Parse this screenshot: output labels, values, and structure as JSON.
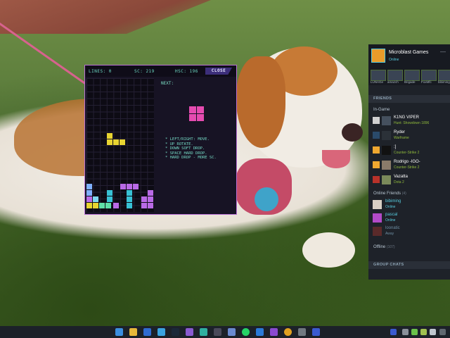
{
  "tetris": {
    "lines_label": "LINES: 0",
    "score_label": "SC: 219",
    "hiscore_label": "HSC: 196",
    "close_label": "CLOSE",
    "next_label": "NEXT:",
    "help_text": "* LEFT/RIGHT: MOVE.\n* UP ROTATE.\n* DOWN SOFT DROP.\n* SPACE HARD DROP.\n* HARD DROP - MORE SC."
  },
  "steam": {
    "profile_name": "Microblast Games",
    "profile_status": "Online",
    "minimize_icon": "minimize-icon",
    "recent": [
      {
        "name": "LUNAGe"
      },
      {
        "name": "amazch"
      },
      {
        "name": "Brigade"
      },
      {
        "name": "FoxMfc"
      },
      {
        "name": "bibiming"
      }
    ],
    "friends_header": "FRIENDS",
    "in_game_label": "In-Game",
    "in_game": [
      {
        "name": "K1NG VIPER",
        "game": "Hunt: Showdown 1896",
        "icon": "arrows-icon"
      },
      {
        "name": "Ryder",
        "game": "Warframe",
        "icon": "steam-icon"
      },
      {
        "name": ":]",
        "game": "Counter-Strike 2",
        "icon": "cs2-icon"
      },
      {
        "name": "Rodrigo -IGO-",
        "game": "Counter-Strike 2",
        "icon": "cs2-icon"
      },
      {
        "name": "Vazatta",
        "game": "Dota 2",
        "icon": "dota-icon"
      }
    ],
    "online_label": "Online Friends",
    "online_count": "(4)",
    "online": [
      {
        "name": "bibiming",
        "status": "Online"
      },
      {
        "name": "pascal",
        "status": "Online"
      },
      {
        "name": "loonatic",
        "status": "Away"
      }
    ],
    "offline_label": "Offline",
    "offline_count": "(107)",
    "group_chats_header": "GROUP CHATS"
  },
  "colors": {
    "tetris_accent": "#b86fd6",
    "steam_bg": "#1e2229",
    "ingame_green": "#90ba3c",
    "online_blue": "#57cbde"
  }
}
